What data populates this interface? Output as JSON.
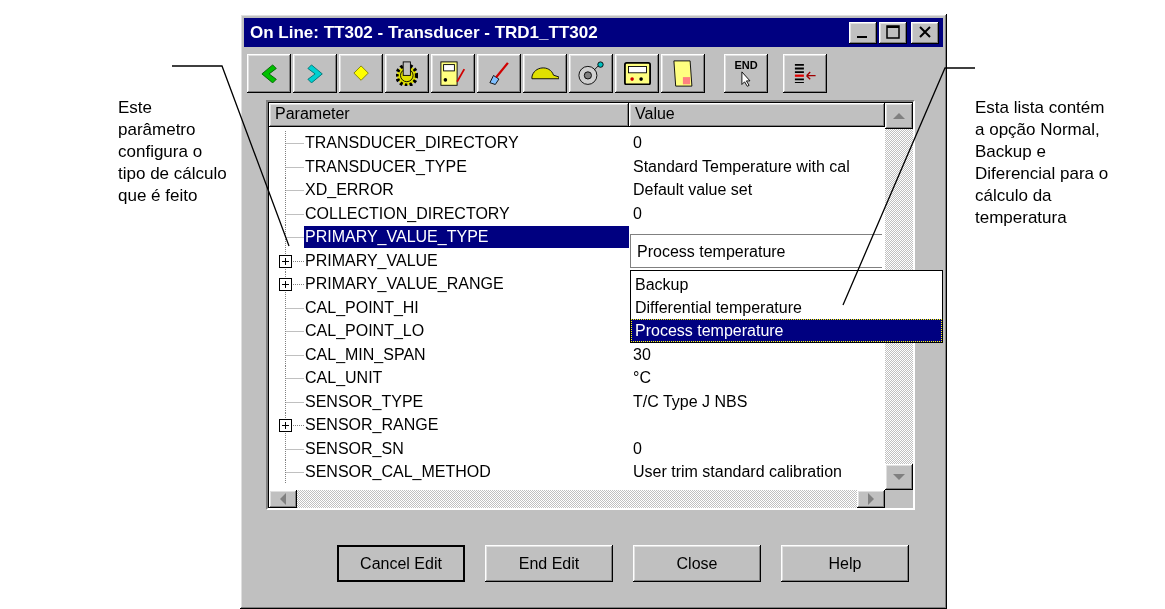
{
  "annotations": [
    {
      "lines": [
        "Este",
        "parâmetro",
        "configura o",
        "tipo de cálculo",
        "que é  feito"
      ]
    },
    {
      "lines": [
        "Esta lista contém",
        "a opção Normal,",
        "Backup e",
        "Diferencial para o",
        "cálculo da",
        "temperatura"
      ]
    }
  ],
  "window": {
    "title": "On Line: TT302 - Transducer - TRD1_TT302"
  },
  "toolbar": {
    "end_label": "END"
  },
  "table": {
    "columns": [
      "Parameter",
      "Value"
    ],
    "rows": [
      {
        "parameter": "TRANSDUCER_DIRECTORY",
        "value": "0",
        "kind": "leaf",
        "selected": false
      },
      {
        "parameter": "TRANSDUCER_TYPE",
        "value": "Standard Temperature with cal",
        "kind": "leaf",
        "selected": false
      },
      {
        "parameter": "XD_ERROR",
        "value": "Default value set",
        "kind": "leaf",
        "selected": false
      },
      {
        "parameter": "COLLECTION_DIRECTORY",
        "value": "0",
        "kind": "leaf",
        "selected": false
      },
      {
        "parameter": "PRIMARY_VALUE_TYPE",
        "kind": "leaf",
        "selected": true
      },
      {
        "parameter": "PRIMARY_VALUE",
        "kind": "group",
        "expanded": false,
        "selected": false
      },
      {
        "parameter": "PRIMARY_VALUE_RANGE",
        "kind": "group",
        "expanded": false,
        "selected": false
      },
      {
        "parameter": "CAL_POINT_HI",
        "kind": "leaf",
        "selected": false
      },
      {
        "parameter": "CAL_POINT_LO",
        "kind": "leaf",
        "selected": false
      },
      {
        "parameter": "CAL_MIN_SPAN",
        "value": "30",
        "kind": "leaf",
        "selected": false
      },
      {
        "parameter": "CAL_UNIT",
        "value": "°C",
        "kind": "leaf",
        "selected": false
      },
      {
        "parameter": "SENSOR_TYPE",
        "value": "T/C Type J NBS",
        "kind": "leaf",
        "selected": false
      },
      {
        "parameter": "SENSOR_RANGE",
        "kind": "group",
        "expanded": false,
        "selected": false
      },
      {
        "parameter": "SENSOR_SN",
        "value": "0",
        "kind": "leaf",
        "selected": false
      },
      {
        "parameter": "SENSOR_CAL_METHOD",
        "value": "User trim standard calibration",
        "kind": "leaf",
        "selected": false
      }
    ]
  },
  "dropdown": {
    "value": "Process temperature",
    "options": [
      {
        "label": "Backup",
        "selected": false
      },
      {
        "label": "Differential temperature",
        "selected": false
      },
      {
        "label": "Process temperature",
        "selected": true
      }
    ]
  },
  "buttons": [
    {
      "label": "Cancel Edit",
      "default": true
    },
    {
      "label": "End Edit",
      "default": false
    },
    {
      "label": "Close",
      "default": false
    },
    {
      "label": "Help",
      "default": false
    }
  ]
}
